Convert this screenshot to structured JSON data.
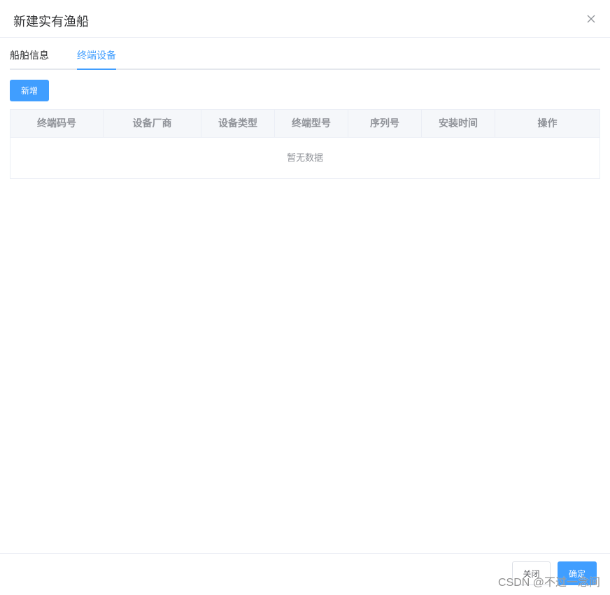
{
  "dialog": {
    "title": "新建实有渔船",
    "close_icon": "close-icon"
  },
  "tabs": [
    {
      "label": "船舶信息",
      "active": false
    },
    {
      "label": "终端设备",
      "active": true
    }
  ],
  "toolbar": {
    "add_label": "新增"
  },
  "table": {
    "columns": [
      "终端码号",
      "设备厂商",
      "设备类型",
      "终端型号",
      "序列号",
      "安装时间",
      "操作"
    ],
    "rows": [],
    "empty_text": "暂无数据"
  },
  "footer": {
    "close_label": "关闭",
    "confirm_label": "确定"
  },
  "watermark": "CSDN @不过一念间",
  "colors": {
    "primary": "#409eff",
    "border": "#ebeef5",
    "header_bg": "#f5f7fa",
    "muted_text": "#909399"
  }
}
